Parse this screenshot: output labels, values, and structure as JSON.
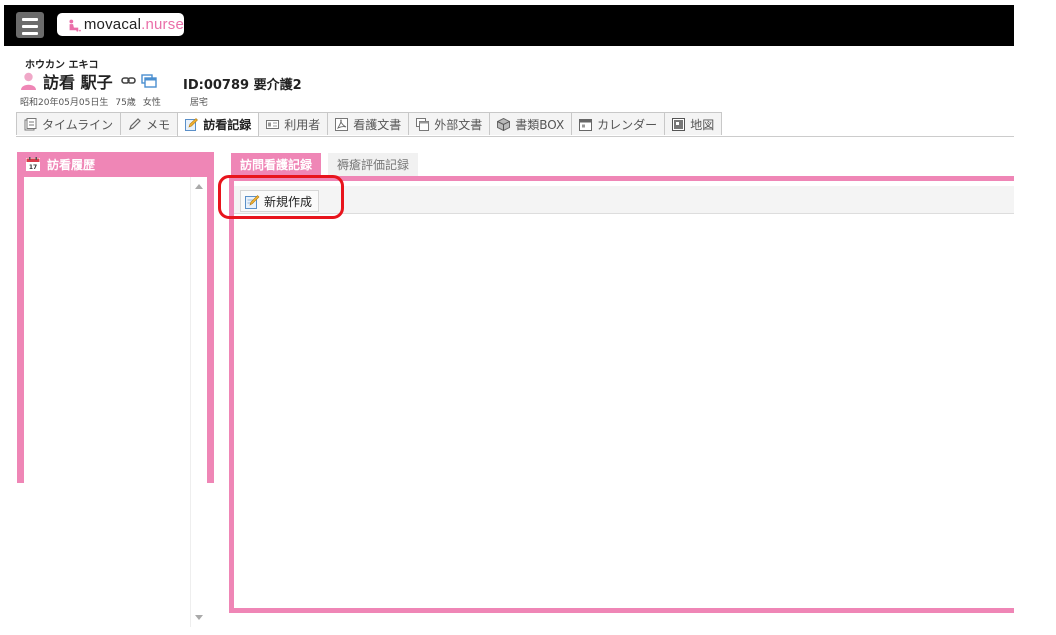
{
  "app": {
    "logo_main": "movacal",
    "logo_sub": ".nurse"
  },
  "patient": {
    "kana": "ホウカン エキコ",
    "name": "訪看 駅子",
    "id": "ID:00789 要介護2",
    "birth": "昭和20年05月05日生",
    "age": "75歳",
    "gender": "女性",
    "residence": "居宅"
  },
  "tabs": [
    {
      "label": "タイムライン",
      "icon": "timeline-icon",
      "active": false
    },
    {
      "label": "メモ",
      "icon": "pencil-icon",
      "active": false
    },
    {
      "label": "訪看記録",
      "icon": "note-edit-icon",
      "active": true
    },
    {
      "label": "利用者",
      "icon": "user-card-icon",
      "active": false
    },
    {
      "label": "看護文書",
      "icon": "pdf-icon",
      "active": false
    },
    {
      "label": "外部文書",
      "icon": "window-icon",
      "active": false
    },
    {
      "label": "書類BOX",
      "icon": "box-icon",
      "active": false
    },
    {
      "label": "カレンダー",
      "icon": "calendar-icon",
      "active": false
    },
    {
      "label": "地図",
      "icon": "map-icon",
      "active": false
    }
  ],
  "left_panel": {
    "title": "訪看履歴",
    "icon": "calendar-icon"
  },
  "main": {
    "tabs": [
      {
        "label": "訪問看護記録",
        "active": true
      },
      {
        "label": "褥瘡評価記録",
        "active": false
      }
    ],
    "new_button": "新規作成"
  },
  "colors": {
    "accent_pink": "#ef86b6",
    "highlight_red": "#e8141c",
    "topbar": "#000000"
  }
}
